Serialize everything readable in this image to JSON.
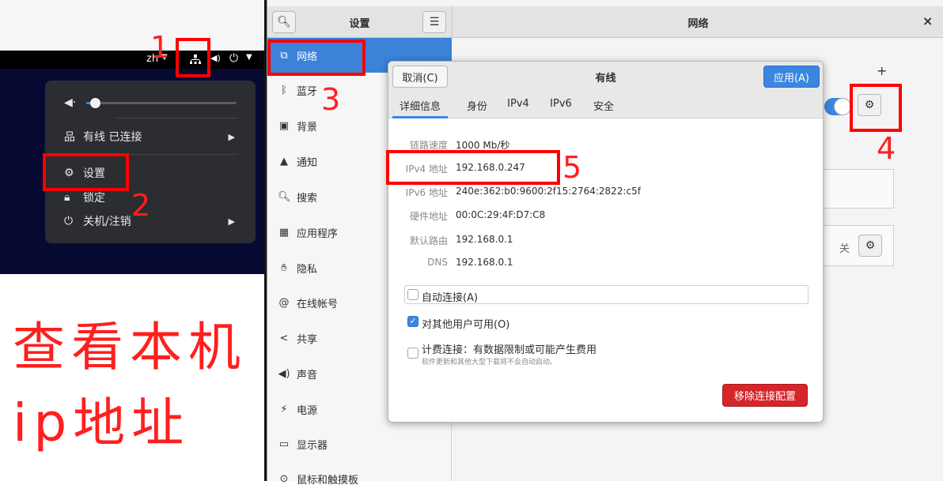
{
  "left_panel": {
    "topbar": {
      "lang": "zh"
    },
    "menu": {
      "volume_icon": "speaker-icon",
      "volume_level": 0.1,
      "wired_label": "有线 已连接",
      "settings_label": "设置",
      "lock_label": "锁定",
      "power_label": "关机/注销"
    },
    "annotation_title_line1": "查看本机",
    "annotation_title_line2": "ip地址",
    "step_numbers": [
      "1",
      "2",
      "3",
      "4",
      "5"
    ]
  },
  "settings": {
    "header": {
      "title_left": "设置",
      "title_right": "网络",
      "close": "×"
    },
    "sidebar": {
      "items": [
        {
          "label": "网络",
          "icon": "network-icon"
        },
        {
          "label": "蓝牙",
          "icon": "bluetooth-icon"
        },
        {
          "label": "背景",
          "icon": "background-icon"
        },
        {
          "label": "通知",
          "icon": "bell-icon"
        },
        {
          "label": "搜索",
          "icon": "search-icon"
        },
        {
          "label": "应用程序",
          "icon": "apps-icon"
        },
        {
          "label": "隐私",
          "icon": "hand-icon"
        },
        {
          "label": "在线帐号",
          "icon": "at-icon"
        },
        {
          "label": "共享",
          "icon": "share-icon"
        },
        {
          "label": "声音",
          "icon": "speaker-icon"
        },
        {
          "label": "电源",
          "icon": "power-icon"
        },
        {
          "label": "显示器",
          "icon": "display-icon"
        },
        {
          "label": "鼠标和触摸板",
          "icon": "mouse-icon"
        }
      ]
    },
    "content": {
      "plus": "+",
      "off_label": "关"
    }
  },
  "dialog": {
    "cancel": "取消(C)",
    "title": "有线",
    "apply": "应用(A)",
    "tabs": [
      "详细信息",
      "身份",
      "IPv4",
      "IPv6",
      "安全"
    ],
    "details": [
      {
        "label": "链路速度",
        "value": "1000 Mb/秒"
      },
      {
        "label": "IPv4 地址",
        "value": "192.168.0.247"
      },
      {
        "label": "IPv6 地址",
        "value": "240e:362:b0:9600:2f15:2764:2822:c5f"
      },
      {
        "label": "硬件地址",
        "value": "00:0C:29:4F:D7:C8"
      },
      {
        "label": "默认路由",
        "value": "192.168.0.1"
      },
      {
        "label": "DNS",
        "value": "192.168.0.1"
      }
    ],
    "auto_connect": "自动连接(A)",
    "available_all": "对其他用户可用(O)",
    "metered": "计费连接：有数据限制或可能产生费用",
    "metered_note": "软件更新和其他大型下载将不会自动启动。",
    "remove": "移除连接配置"
  },
  "colors": {
    "accent": "#3b86e0",
    "annotation_red": "#ff0000",
    "danger": "#d6252a"
  }
}
